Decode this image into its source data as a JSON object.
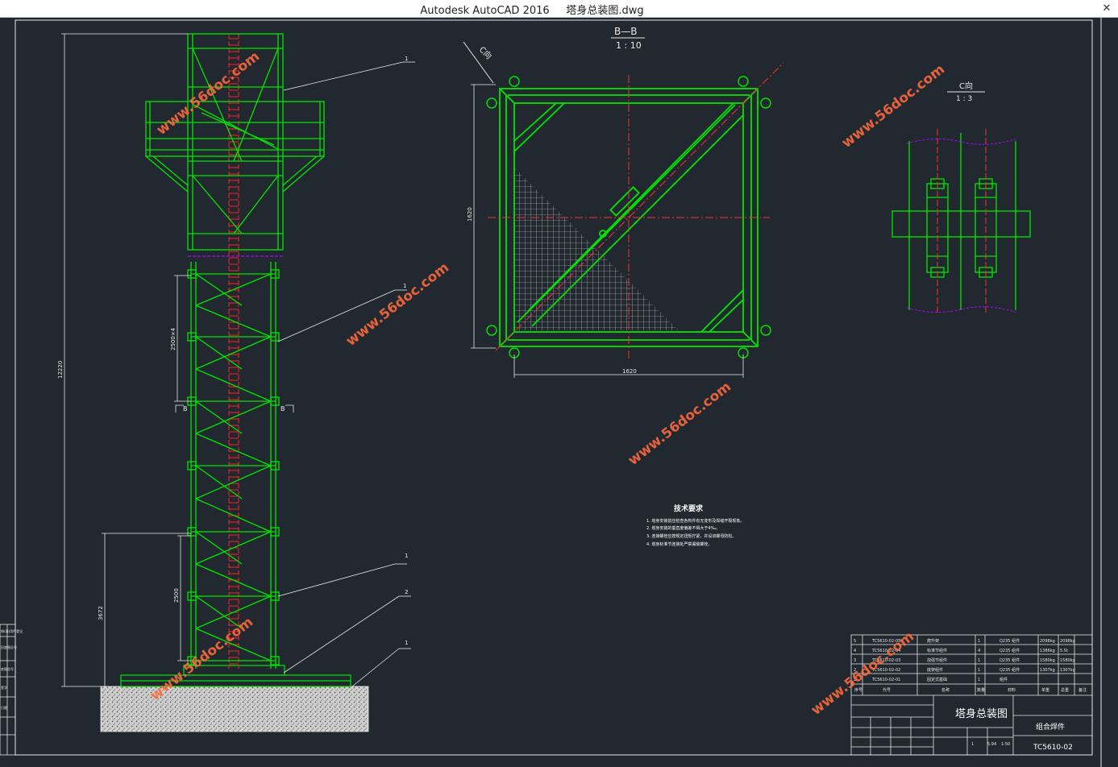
{
  "window": {
    "title": "Autodesk AutoCAD 2016     塔身总装图.dwg",
    "close_glyph": "✕"
  },
  "drawing": {
    "section_label": "B—B",
    "section_scale": "1 : 10",
    "detail_label_c": "C向",
    "detail_c_title": "C向",
    "detail_c_scale": "1 : 3",
    "cut_mark_left": "B",
    "cut_mark_right": "B",
    "dim_total_height": "12220",
    "dim_section_a": "2500×4",
    "dim_section_b": "2500",
    "dim_base_height": "3672",
    "dim_plan_width": "1620",
    "dim_plan_height": "1620",
    "callouts": [
      "1",
      "1",
      "1",
      "2",
      "1"
    ],
    "watermark": "www.56doc.com",
    "tech_title": "技术要求",
    "tech_lines": [
      "1. 塔身安装前应检查各构件有无变形及焊缝开裂现象。",
      "2. 塔身安装的垂直度偏差不得大于4‰。",
      "3. 连接螺栓应按规定扭矩拧紧，并设双螺母防松。",
      "4. 塔身标准节连接处严禁漏装螺栓。"
    ],
    "colors": {
      "background": "#212830",
      "structure": "#00e600",
      "dimension": "#e8e8e8",
      "centerline": "#ff3030",
      "ladder": "#ff2020",
      "platform_edge": "#b000ff",
      "watermark": "#ff6a3d"
    }
  },
  "title_block": {
    "drawing_title": "塔身总装图",
    "part_type": "组合焊件",
    "drawing_number": "TC5610-02",
    "parts_header": [
      "序号",
      "代号",
      "名称",
      "数量",
      "材料",
      "单重",
      "总重",
      "备注"
    ],
    "parts": [
      {
        "no": "5",
        "code": "TC5610-02-05",
        "name": "爬升架",
        "qty": "1",
        "mat": "Q235 组件",
        "w1": "2098kg",
        "w2": "2098kg"
      },
      {
        "no": "4",
        "code": "TC5610-02-04",
        "name": "标准节组件",
        "qty": "4",
        "mat": "Q235 组件",
        "w1": "1386kg",
        "w2": "5.5t"
      },
      {
        "no": "3",
        "code": "TC5610-02-03",
        "name": "加强节组件",
        "qty": "1",
        "mat": "Q235 组件",
        "w1": "1580kg",
        "w2": "1580kg"
      },
      {
        "no": "2",
        "code": "TC5610-02-02",
        "name": "底架组件",
        "qty": "1",
        "mat": "Q235 组件",
        "w1": "1307kg",
        "w2": "1307kg"
      },
      {
        "no": "1",
        "code": "TC5610-02-01",
        "name": "固定式基础",
        "qty": "1",
        "mat": "组件",
        "w1": "",
        "w2": ""
      }
    ],
    "scale_cells": [
      "1",
      "5.94",
      "1:50"
    ],
    "left_strip": [
      "借(通)用件登记",
      "旧底图总号",
      "底图总号",
      "签字",
      "日期"
    ]
  }
}
